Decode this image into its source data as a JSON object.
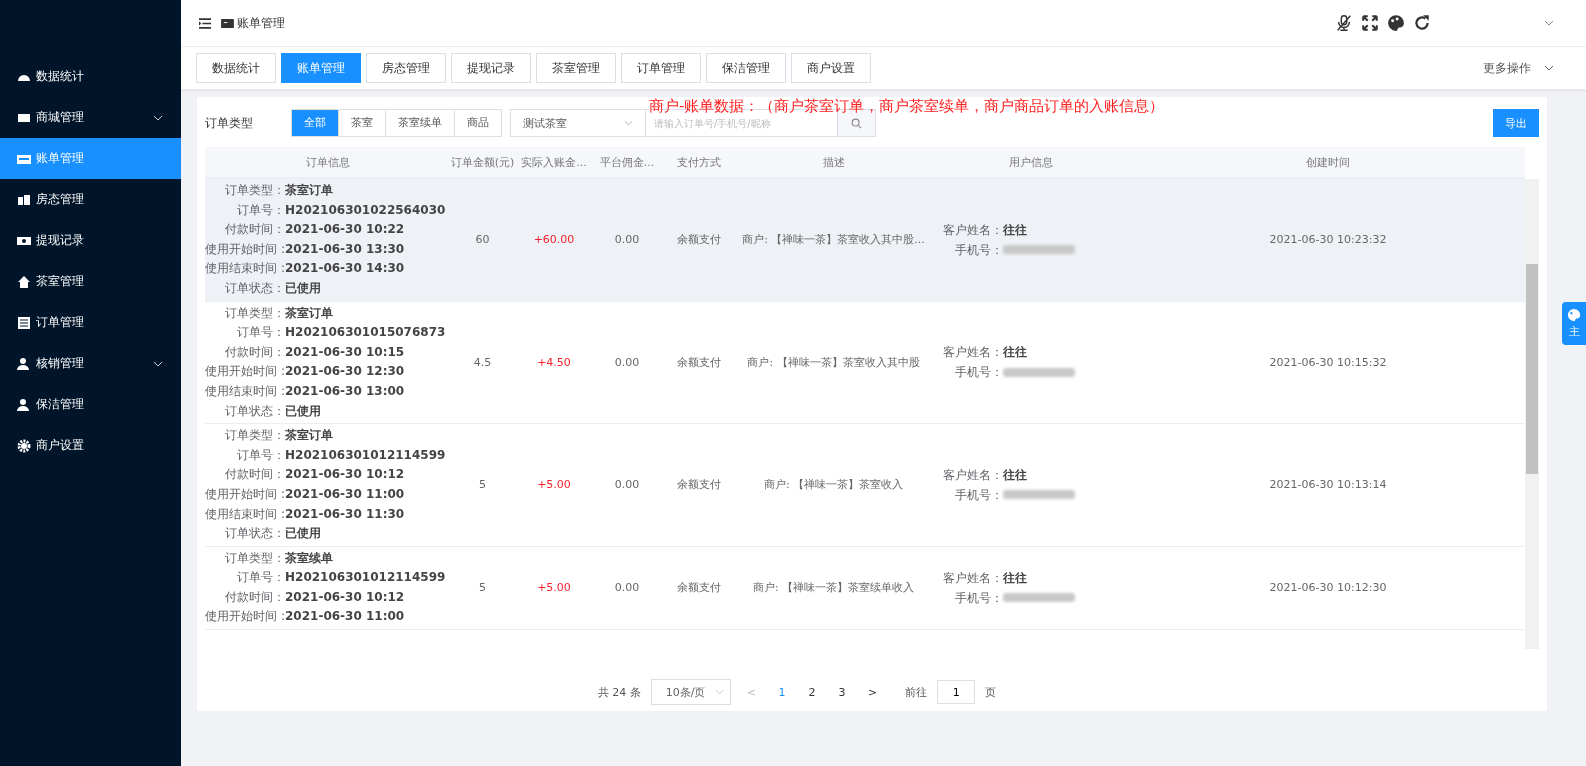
{
  "sidebar": {
    "items": [
      {
        "label": "数据统计",
        "expandable": false,
        "selected": false
      },
      {
        "label": "商城管理",
        "expandable": true,
        "selected": false
      },
      {
        "label": "账单管理",
        "expandable": false,
        "selected": true
      },
      {
        "label": "房态管理",
        "expandable": false,
        "selected": false
      },
      {
        "label": "提现记录",
        "expandable": false,
        "selected": false
      },
      {
        "label": "茶室管理",
        "expandable": false,
        "selected": false
      },
      {
        "label": "订单管理",
        "expandable": false,
        "selected": false
      },
      {
        "label": "核销管理",
        "expandable": true,
        "selected": false
      },
      {
        "label": "保洁管理",
        "expandable": false,
        "selected": false
      },
      {
        "label": "商户设置",
        "expandable": false,
        "selected": false
      }
    ]
  },
  "header": {
    "breadcrumb": "账单管理"
  },
  "tabs": [
    {
      "label": "数据统计",
      "selected": false
    },
    {
      "label": "账单管理",
      "selected": true
    },
    {
      "label": "房态管理",
      "selected": false
    },
    {
      "label": "提现记录",
      "selected": false
    },
    {
      "label": "茶室管理",
      "selected": false
    },
    {
      "label": "订单管理",
      "selected": false
    },
    {
      "label": "保洁管理",
      "selected": false
    },
    {
      "label": "商户设置",
      "selected": false
    }
  ],
  "more_actions": "更多操作",
  "filter": {
    "label": "订单类型",
    "types": [
      {
        "label": "全部",
        "selected": true
      },
      {
        "label": "茶室",
        "selected": false
      },
      {
        "label": "茶室续单",
        "selected": false
      },
      {
        "label": "商品",
        "selected": false
      }
    ],
    "room_select": "测试茶室",
    "search": {
      "placeholder": "请输入订单号/手机号/昵称"
    },
    "export_button": "导出"
  },
  "note": "商户-账单数据：（商户茶室订单，商户茶室续单，商户商品订单的入账信息）",
  "table": {
    "columns": [
      "订单信息",
      "订单金额(元)",
      "实际入账金...",
      "平台佣金...",
      "支付方式",
      "描述",
      "用户信息",
      "创建时间"
    ],
    "rows": [
      {
        "highlighted": true,
        "info": [
          [
            "订单类型：",
            "茶室订单"
          ],
          [
            "订单号：",
            "H202106301022564030"
          ],
          [
            "付款时间：",
            "2021-06-30 10:22"
          ],
          [
            "使用开始时间 :",
            "2021-06-30 13:30"
          ],
          [
            "使用结束时间 :",
            "2021-06-30 14:30"
          ],
          [
            "订单状态：",
            "已使用"
          ]
        ],
        "amount": "60",
        "income": "+60.00",
        "commission": "0.00",
        "payment": "余额支付",
        "description": "商户: 【禅味一茶】茶室收入其中股...",
        "customer_label": "客户姓名：",
        "customer": "往往",
        "phone_label": "手机号：",
        "created": "2021-06-30 10:23:32"
      },
      {
        "highlighted": false,
        "info": [
          [
            "订单类型：",
            "茶室订单"
          ],
          [
            "订单号：",
            "H202106301015076873"
          ],
          [
            "付款时间：",
            "2021-06-30 10:15"
          ],
          [
            "使用开始时间 :",
            "2021-06-30 12:30"
          ],
          [
            "使用结束时间 :",
            "2021-06-30 13:00"
          ],
          [
            "订单状态：",
            "已使用"
          ]
        ],
        "amount": "4.5",
        "income": "+4.50",
        "commission": "0.00",
        "payment": "余额支付",
        "description": "商户: 【禅味一茶】茶室收入其中股",
        "customer_label": "客户姓名：",
        "customer": "往往",
        "phone_label": "手机号：",
        "created": "2021-06-30 10:15:32"
      },
      {
        "highlighted": false,
        "info": [
          [
            "订单类型：",
            "茶室订单"
          ],
          [
            "订单号：",
            "H202106301012114599"
          ],
          [
            "付款时间：",
            "2021-06-30 10:12"
          ],
          [
            "使用开始时间 :",
            "2021-06-30 11:00"
          ],
          [
            "使用结束时间 :",
            "2021-06-30 11:30"
          ],
          [
            "订单状态：",
            "已使用"
          ]
        ],
        "amount": "5",
        "income": "+5.00",
        "commission": "0.00",
        "payment": "余额支付",
        "description": "商户: 【禅味一茶】茶室收入",
        "customer_label": "客户姓名：",
        "customer": "往往",
        "phone_label": "手机号：",
        "created": "2021-06-30 10:13:14"
      },
      {
        "highlighted": false,
        "info": [
          [
            "订单类型：",
            "茶室续单"
          ],
          [
            "订单号：",
            "H202106301012114599"
          ],
          [
            "付款时间：",
            "2021-06-30 10:12"
          ],
          [
            "使用开始时间 :",
            "2021-06-30 11:00"
          ]
        ],
        "amount": "5",
        "income": "+5.00",
        "commission": "0.00",
        "payment": "余额支付",
        "description": "商户: 【禅味一茶】茶室续单收入",
        "customer_label": "客户姓名：",
        "customer": "往往",
        "phone_label": "手机号：",
        "created": "2021-06-30 10:12:30"
      }
    ]
  },
  "pagination": {
    "total": "共 24 条",
    "page_size": "10条/页",
    "prev": "<",
    "pages": [
      {
        "label": "1",
        "selected": true
      },
      {
        "label": "2",
        "selected": false
      },
      {
        "label": "3",
        "selected": false
      }
    ],
    "next": ">",
    "goto_label": "前往",
    "goto_value": "1",
    "goto_suffix": "页"
  },
  "theme_tab": "主"
}
